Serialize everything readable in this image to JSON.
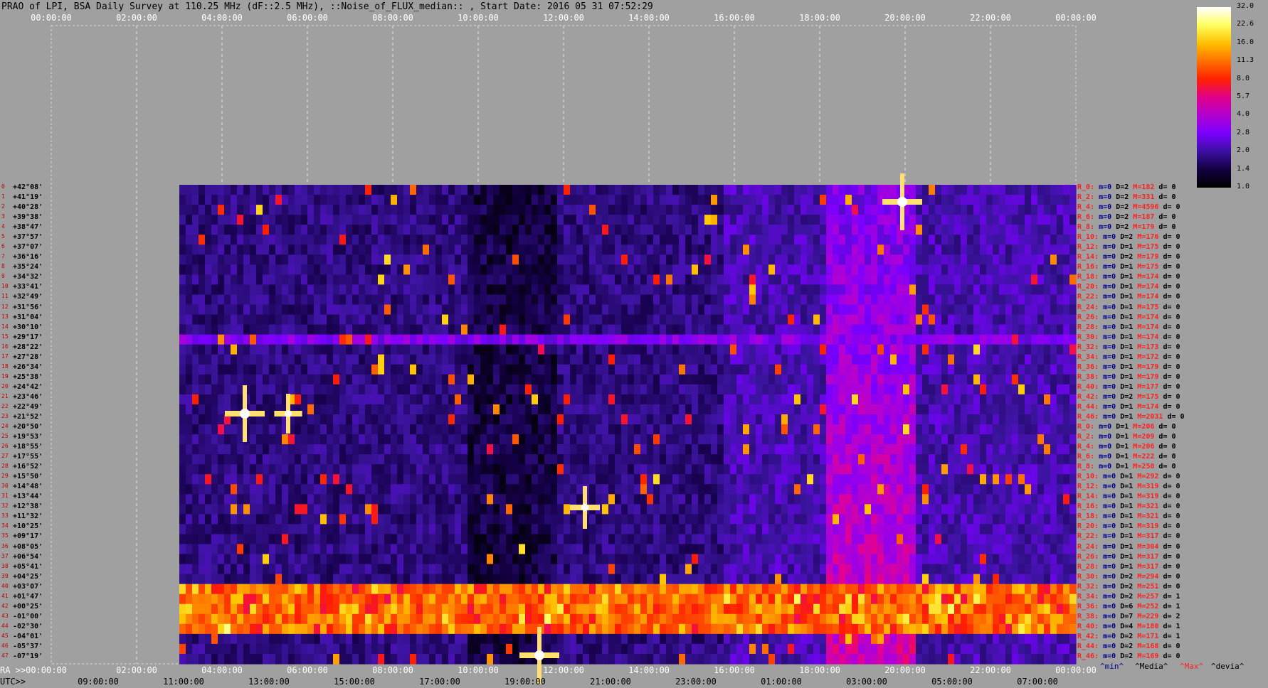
{
  "title": "PRAO of LPI, BSA Daily Survey at 110.25 MHz (dF::2.5 MHz), ::Noise_of_FLUX_median:: , Start Date: 2016 05 31 07:52:29",
  "colors": {
    "background": "#a0a0a0",
    "grid": "#e8e8e8",
    "label_red": "#ff2020",
    "label_blue": "#000090"
  },
  "chart_data": {
    "type": "heatmap",
    "title": "PRAO of LPI, BSA Daily Survey at 110.25 MHz (dF::2.5 MHz), ::Noise_of_FLUX_median:: , Start Date: 2016 05 31 07:52:29",
    "x_top_ticks": [
      "00:00:00",
      "02:00:00",
      "04:00:00",
      "06:00:00",
      "08:00:00",
      "10:00:00",
      "12:00:00",
      "14:00:00",
      "16:00:00",
      "18:00:00",
      "20:00:00",
      "22:00:00",
      "00:00:00"
    ],
    "x_bottom_ra_ticks": [
      "RA >>00:00:00",
      "02:00:00",
      "04:00:00",
      "06:00:00",
      "08:00:00",
      "10:00:00",
      "12:00:00",
      "14:00:00",
      "16:00:00",
      "18:00:00",
      "20:00:00",
      "22:00:00",
      "00:00:00"
    ],
    "x_bottom_utc_ticks": [
      "UTC>>",
      "09:00:00",
      "11:00:00",
      "13:00:00",
      "15:00:00",
      "17:00:00",
      "19:00:00",
      "21:00:00",
      "23:00:00",
      "01:00:00",
      "03:00:00",
      "05:00:00",
      "07:00:00"
    ],
    "declinations": [
      "+42°08'",
      "+41°19'",
      "+40°28'",
      "+39°38'",
      "+38°47'",
      "+37°57'",
      "+37°07'",
      "+36°16'",
      "+35°24'",
      "+34°32'",
      "+33°41'",
      "+32°49'",
      "+31°56'",
      "+31°04'",
      "+30°10'",
      "+29°17'",
      "+28°22'",
      "+27°28'",
      "+26°34'",
      "+25°38'",
      "+24°42'",
      "+23°46'",
      "+22°49'",
      "+21°52'",
      "+20°50'",
      "+19°53'",
      "+18°55'",
      "+17°55'",
      "+16°52'",
      "+15°50'",
      "+14°48'",
      "+13°44'",
      "+12°38'",
      "+11°32'",
      "+10°25'",
      "+09°17'",
      "+08°05'",
      "+06°54'",
      "+05°41'",
      "+04°25'",
      "+03°07'",
      "+01°47'",
      "+00°25'",
      "-01°00'",
      "-02°30'",
      "-04°01'",
      "-05°37'",
      "-07°19'"
    ],
    "colorbar": {
      "ticks": [
        "32.0",
        "22.6",
        "16.0",
        "11.3",
        "8.0",
        "5.7",
        "4.0",
        "2.8",
        "2.0",
        "1.4",
        "1.0"
      ],
      "stops": [
        "#ffffff",
        "#ffff60",
        "#ffc000",
        "#ff7000",
        "#ff2000",
        "#e0008a",
        "#b000d0",
        "#7a00ff",
        "#3a10a0",
        "#120040",
        "#000000"
      ]
    },
    "rows": [
      {
        "r": "R_0:",
        "m": "m=0",
        "d": "D=2",
        "M": "M=182",
        "dd": "d= 0"
      },
      {
        "r": "R_2:",
        "m": "m=0",
        "d": "D=2",
        "M": "M=331",
        "dd": "d= 0"
      },
      {
        "r": "R_4:",
        "m": "m=0",
        "d": "D=2",
        "M": "M=4596",
        "dd": "d= 0"
      },
      {
        "r": "R_6:",
        "m": "m=0",
        "d": "D=2",
        "M": "M=187",
        "dd": "d= 0"
      },
      {
        "r": "R_8:",
        "m": "m=0",
        "d": "D=2",
        "M": "M=179",
        "dd": "d= 0"
      },
      {
        "r": "R_10:",
        "m": "m=0",
        "d": "D=2",
        "M": "M=176",
        "dd": "d= 0"
      },
      {
        "r": "R_12:",
        "m": "m=0",
        "d": "D=1",
        "M": "M=175",
        "dd": "d= 0"
      },
      {
        "r": "R_14:",
        "m": "m=0",
        "d": "D=2",
        "M": "M=179",
        "dd": "d= 0"
      },
      {
        "r": "R_16:",
        "m": "m=0",
        "d": "D=1",
        "M": "M=175",
        "dd": "d= 0"
      },
      {
        "r": "R_18:",
        "m": "m=0",
        "d": "D=1",
        "M": "M=174",
        "dd": "d= 0"
      },
      {
        "r": "R_20:",
        "m": "m=0",
        "d": "D=1",
        "M": "M=174",
        "dd": "d= 0"
      },
      {
        "r": "R_22:",
        "m": "m=0",
        "d": "D=1",
        "M": "M=174",
        "dd": "d= 0"
      },
      {
        "r": "R_24:",
        "m": "m=0",
        "d": "D=1",
        "M": "M=175",
        "dd": "d= 0"
      },
      {
        "r": "R_26:",
        "m": "m=0",
        "d": "D=1",
        "M": "M=174",
        "dd": "d= 0"
      },
      {
        "r": "R_28:",
        "m": "m=0",
        "d": "D=1",
        "M": "M=174",
        "dd": "d= 0"
      },
      {
        "r": "R_30:",
        "m": "m=0",
        "d": "D=1",
        "M": "M=174",
        "dd": "d= 0"
      },
      {
        "r": "R_32:",
        "m": "m=0",
        "d": "D=1",
        "M": "M=173",
        "dd": "d= 0"
      },
      {
        "r": "R_34:",
        "m": "m=0",
        "d": "D=1",
        "M": "M=172",
        "dd": "d= 0"
      },
      {
        "r": "R_36:",
        "m": "m=0",
        "d": "D=1",
        "M": "M=179",
        "dd": "d= 0"
      },
      {
        "r": "R_38:",
        "m": "m=0",
        "d": "D=1",
        "M": "M=179",
        "dd": "d= 0"
      },
      {
        "r": "R_40:",
        "m": "m=0",
        "d": "D=1",
        "M": "M=177",
        "dd": "d= 0"
      },
      {
        "r": "R_42:",
        "m": "m=0",
        "d": "D=2",
        "M": "M=175",
        "dd": "d= 0"
      },
      {
        "r": "R_44:",
        "m": "m=0",
        "d": "D=1",
        "M": "M=174",
        "dd": "d= 0"
      },
      {
        "r": "R_46:",
        "m": "m=0",
        "d": "D=1",
        "M": "M=2031",
        "dd": "d= 0"
      },
      {
        "r": "R_0:",
        "m": "m=0",
        "d": "D=1",
        "M": "M=206",
        "dd": "d= 0"
      },
      {
        "r": "R_2:",
        "m": "m=0",
        "d": "D=1",
        "M": "M=209",
        "dd": "d= 0"
      },
      {
        "r": "R_4:",
        "m": "m=0",
        "d": "D=1",
        "M": "M=206",
        "dd": "d= 0"
      },
      {
        "r": "R_6:",
        "m": "m=0",
        "d": "D=1",
        "M": "M=222",
        "dd": "d= 0"
      },
      {
        "r": "R_8:",
        "m": "m=0",
        "d": "D=1",
        "M": "M=250",
        "dd": "d= 0"
      },
      {
        "r": "R_10:",
        "m": "m=0",
        "d": "D=1",
        "M": "M=292",
        "dd": "d= 0"
      },
      {
        "r": "R_12:",
        "m": "m=0",
        "d": "D=1",
        "M": "M=319",
        "dd": "d= 0"
      },
      {
        "r": "R_14:",
        "m": "m=0",
        "d": "D=1",
        "M": "M=319",
        "dd": "d= 0"
      },
      {
        "r": "R_16:",
        "m": "m=0",
        "d": "D=1",
        "M": "M=321",
        "dd": "d= 0"
      },
      {
        "r": "R_18:",
        "m": "m=0",
        "d": "D=1",
        "M": "M=321",
        "dd": "d= 0"
      },
      {
        "r": "R_20:",
        "m": "m=0",
        "d": "D=1",
        "M": "M=319",
        "dd": "d= 0"
      },
      {
        "r": "R_22:",
        "m": "m=0",
        "d": "D=1",
        "M": "M=317",
        "dd": "d= 0"
      },
      {
        "r": "R_24:",
        "m": "m=0",
        "d": "D=1",
        "M": "M=304",
        "dd": "d= 0"
      },
      {
        "r": "R_26:",
        "m": "m=0",
        "d": "D=1",
        "M": "M=317",
        "dd": "d= 0"
      },
      {
        "r": "R_28:",
        "m": "m=0",
        "d": "D=1",
        "M": "M=317",
        "dd": "d= 0"
      },
      {
        "r": "R_30:",
        "m": "m=0",
        "d": "D=2",
        "M": "M=294",
        "dd": "d= 0"
      },
      {
        "r": "R_32:",
        "m": "m=0",
        "d": "D=2",
        "M": "M=251",
        "dd": "d= 0"
      },
      {
        "r": "R_34:",
        "m": "m=0",
        "d": "D=2",
        "M": "M=257",
        "dd": "d= 1"
      },
      {
        "r": "R_36:",
        "m": "m=0",
        "d": "D=6",
        "M": "M=252",
        "dd": "d= 1"
      },
      {
        "r": "R_38:",
        "m": "m=0",
        "d": "D=7",
        "M": "M=229",
        "dd": "d= 2"
      },
      {
        "r": "R_40:",
        "m": "m=0",
        "d": "D=4",
        "M": "M=180",
        "dd": "d= 1"
      },
      {
        "r": "R_42:",
        "m": "m=0",
        "d": "D=2",
        "M": "M=171",
        "dd": "d= 1"
      },
      {
        "r": "R_44:",
        "m": "m=0",
        "d": "D=2",
        "M": "M=168",
        "dd": "d= 0"
      },
      {
        "r": "R_46:",
        "m": "m=0",
        "d": "D=2",
        "M": "M=169",
        "dd": "d= 0"
      }
    ],
    "legend": [
      {
        "label": "^min^",
        "color": "#000090"
      },
      {
        "label": "^Media^",
        "color": "#000000"
      },
      {
        "label": "^Max^",
        "color": "#ff2020"
      },
      {
        "label": "^devia^",
        "color": "#000000"
      }
    ]
  }
}
